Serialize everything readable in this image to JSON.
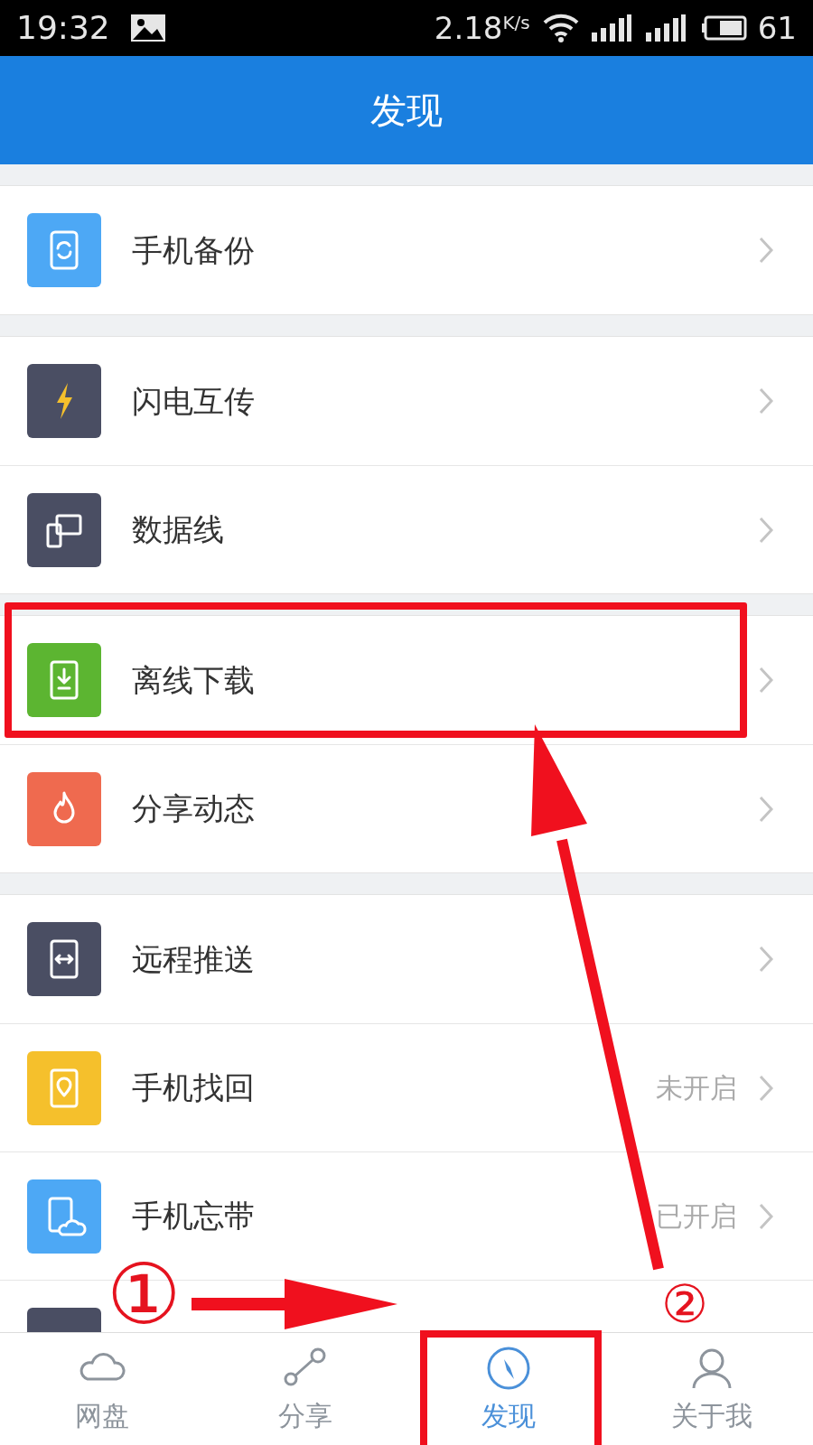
{
  "status_bar": {
    "time": "19:32",
    "speed": "2.18",
    "speed_unit": "K/s",
    "battery": "61"
  },
  "header": {
    "title": "发现"
  },
  "groups": [
    {
      "items": [
        {
          "kind": "backup",
          "label": "手机备份",
          "color": "#4da8f5"
        }
      ]
    },
    {
      "items": [
        {
          "kind": "bolt",
          "label": "闪电互传",
          "color": "#4a4e63"
        },
        {
          "kind": "cable",
          "label": "数据线",
          "color": "#4a4e63"
        }
      ]
    },
    {
      "items": [
        {
          "kind": "download",
          "label": "离线下载",
          "color": "#5cb531"
        },
        {
          "kind": "flame",
          "label": "分享动态",
          "color": "#ef6a4f"
        }
      ]
    },
    {
      "items": [
        {
          "kind": "push",
          "label": "远程推送",
          "color": "#4a4e63"
        },
        {
          "kind": "locate",
          "label": "手机找回",
          "value": "未开启",
          "color": "#f5c02c"
        },
        {
          "kind": "cloud",
          "label": "手机忘带",
          "value": "已开启",
          "color": "#4da8f5"
        },
        {
          "kind": "media",
          "color": "#4a4e63"
        }
      ]
    }
  ],
  "tabs": [
    {
      "kind": "cloud",
      "label": "网盘",
      "selected": false
    },
    {
      "kind": "share",
      "label": "分享",
      "selected": false
    },
    {
      "kind": "compass",
      "label": "发现",
      "selected": true
    },
    {
      "kind": "person",
      "label": "关于我",
      "selected": false
    }
  ],
  "annotations": {
    "markers": [
      {
        "label": "①"
      },
      {
        "label": "②"
      }
    ]
  }
}
